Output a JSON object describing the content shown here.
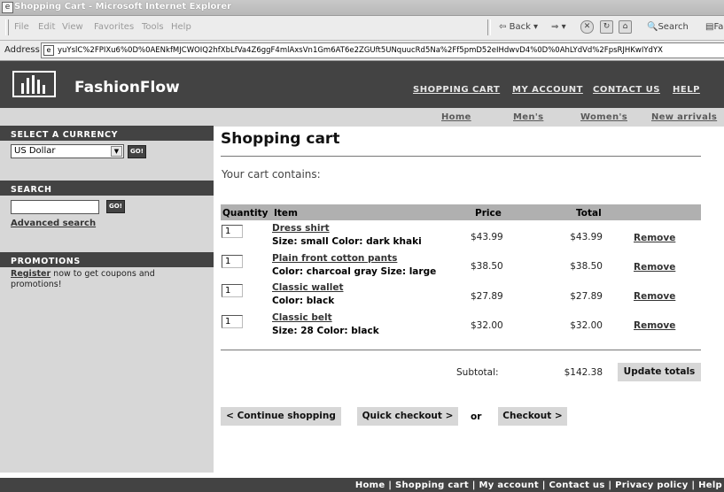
{
  "window": {
    "title": "Shopping Cart - Microsoft Internet Explorer"
  },
  "browser": {
    "menu": [
      "File",
      "Edit",
      "View",
      "Favorites",
      "Tools",
      "Help"
    ],
    "toolbar": {
      "back": "Back",
      "search": "Search",
      "favorites": "Fa"
    },
    "address_label": "Address",
    "url": "yuYslC%2FPIXu6%0D%0AENkfMJCWOIQ2hfXbLfVa4Z6ggF4mlAxsVn1Gm6AT6e2ZGUft5UNquucRd5Na%2Ff5pmD52eIHdwvD4%0D%0AhLYdVd%2FpsRJHKwIYdYX"
  },
  "header": {
    "brand": "FashionFlow",
    "links": [
      "SHOPPING CART",
      "MY ACCOUNT",
      "CONTACT US",
      "HELP"
    ]
  },
  "subnav": [
    "Home",
    "Men's",
    "Women's",
    "New arrivals"
  ],
  "sidebar": {
    "currency_heading": "SELECT A CURRENCY",
    "currency_selected": "US Dollar",
    "go_label": "GO!",
    "search_heading": "SEARCH",
    "advanced_search": "Advanced search",
    "promotions_heading": "PROMOTIONS",
    "promo_link": "Register",
    "promo_text": "now to get coupons and promotions!"
  },
  "main": {
    "title": "Shopping cart",
    "intro": "Your cart contains:",
    "columns": [
      "Quantity",
      "Item",
      "Price",
      "Total"
    ],
    "items": [
      {
        "qty": "1",
        "name": "Dress shirt",
        "desc": "Size: small   Color: dark khaki",
        "price": "$43.99",
        "total": "$43.99",
        "remove": "Remove"
      },
      {
        "qty": "1",
        "name": "Plain front cotton pants",
        "desc": "Color: charcoal gray   Size: large",
        "price": "$38.50",
        "total": "$38.50",
        "remove": "Remove"
      },
      {
        "qty": "1",
        "name": "Classic wallet",
        "desc": "Color: black",
        "price": "$27.89",
        "total": "$27.89",
        "remove": "Remove"
      },
      {
        "qty": "1",
        "name": "Classic belt",
        "desc": "Size: 28   Color: black",
        "price": "$32.00",
        "total": "$32.00",
        "remove": "Remove"
      }
    ],
    "subtotal_label": "Subtotal:",
    "subtotal_value": "$142.38",
    "update_totals": "Update totals",
    "continue_shopping": "< Continue shopping",
    "quick_checkout": "Quick checkout >",
    "or": "or",
    "checkout": "Checkout >"
  },
  "footer": {
    "links": [
      "Home",
      "Shopping cart",
      "My account",
      "Contact us",
      "Privacy policy",
      "Help"
    ]
  }
}
